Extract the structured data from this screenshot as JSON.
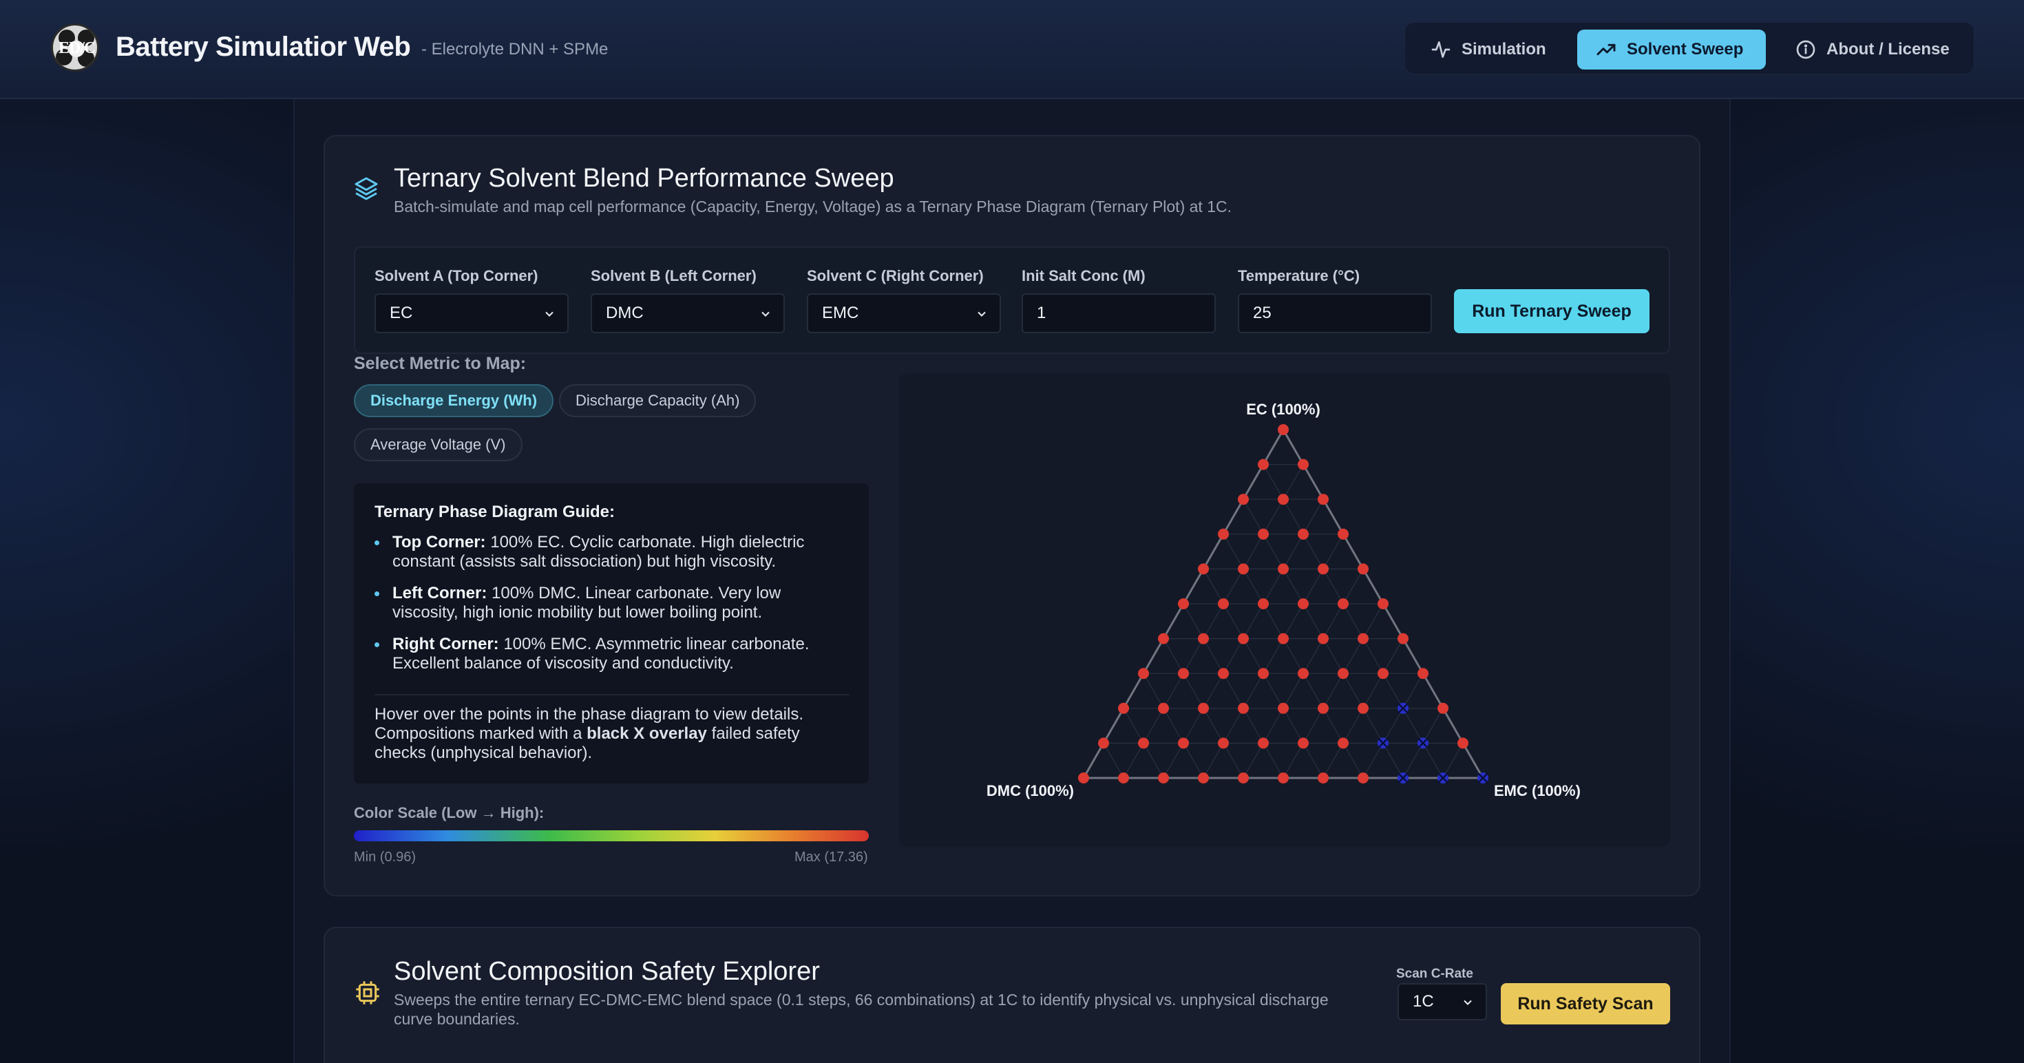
{
  "app": {
    "title": "Battery Simulatior Web",
    "subtitle": "- Elecrolyte DNN + SPMe",
    "logo_text": "ED/C"
  },
  "nav": {
    "items": [
      {
        "label": "Simulation",
        "icon": "activity-icon",
        "active": false
      },
      {
        "label": "Solvent Sweep",
        "icon": "trending-up-icon",
        "active": true
      },
      {
        "label": "About / License",
        "icon": "info-icon",
        "active": false
      }
    ]
  },
  "ternary": {
    "title": "Ternary Solvent Blend Performance Sweep",
    "description": "Batch-simulate and map cell performance (Capacity, Energy, Voltage) as a Ternary Phase Diagram (Ternary Plot) at 1C.",
    "controls": {
      "solvent_a": {
        "label": "Solvent A (Top Corner)",
        "value": "EC"
      },
      "solvent_b": {
        "label": "Solvent B (Left Corner)",
        "value": "DMC"
      },
      "solvent_c": {
        "label": "Solvent C (Right Corner)",
        "value": "EMC"
      },
      "salt_conc": {
        "label": "Init Salt Conc (M)",
        "value": "1"
      },
      "temperature": {
        "label": "Temperature (°C)",
        "value": "25"
      },
      "run_label": "Run Ternary Sweep"
    },
    "metric": {
      "label": "Select Metric to Map:",
      "options": [
        {
          "label": "Discharge Energy (Wh)",
          "active": true
        },
        {
          "label": "Discharge Capacity (Ah)",
          "active": false
        },
        {
          "label": "Average Voltage (V)",
          "active": false
        }
      ]
    },
    "guide": {
      "title": "Ternary Phase Diagram Guide:",
      "items": [
        {
          "bold": "Top Corner:",
          "text": " 100% EC. Cyclic carbonate. High dielectric constant (assists salt dissociation) but high viscosity."
        },
        {
          "bold": "Left Corner:",
          "text": " 100% DMC. Linear carbonate. Very low viscosity, high ionic mobility but lower boiling point."
        },
        {
          "bold": "Right Corner:",
          "text": " 100% EMC. Asymmetric linear carbonate. Excellent balance of viscosity and conductivity."
        }
      ],
      "note_pre": "Hover over the points in the phase diagram to view details. Compositions marked with a ",
      "note_bold": "black X overlay",
      "note_post": " failed safety checks (unphysical behavior)."
    },
    "scale": {
      "label": "Color Scale (Low → High):",
      "min": "Min (0.96)",
      "max": "Max (17.36)"
    },
    "plot": {
      "top_label": "EC (100%)",
      "left_label": "DMC (100%)",
      "right_label": "EMC (100%)",
      "point_color": "#dc3a32",
      "fail_color": "#2730c8",
      "steps": 10,
      "failed_points": [
        [
          2,
          7
        ],
        [
          1,
          8
        ],
        [
          1,
          7
        ],
        [
          0,
          8
        ],
        [
          0,
          9
        ],
        [
          0,
          10
        ]
      ]
    }
  },
  "safety": {
    "title": "Solvent Composition Safety Explorer",
    "description": "Sweeps the entire ternary EC-DMC-EMC blend space (0.1 steps, 66 combinations) at 1C to identify physical vs. unphysical discharge curve boundaries.",
    "rate_label": "Scan C-Rate",
    "rate_value": "1C",
    "run_label": "Run Safety Scan"
  },
  "colors": {
    "accent": "#58d6ee",
    "warning": "#ebc85a"
  }
}
